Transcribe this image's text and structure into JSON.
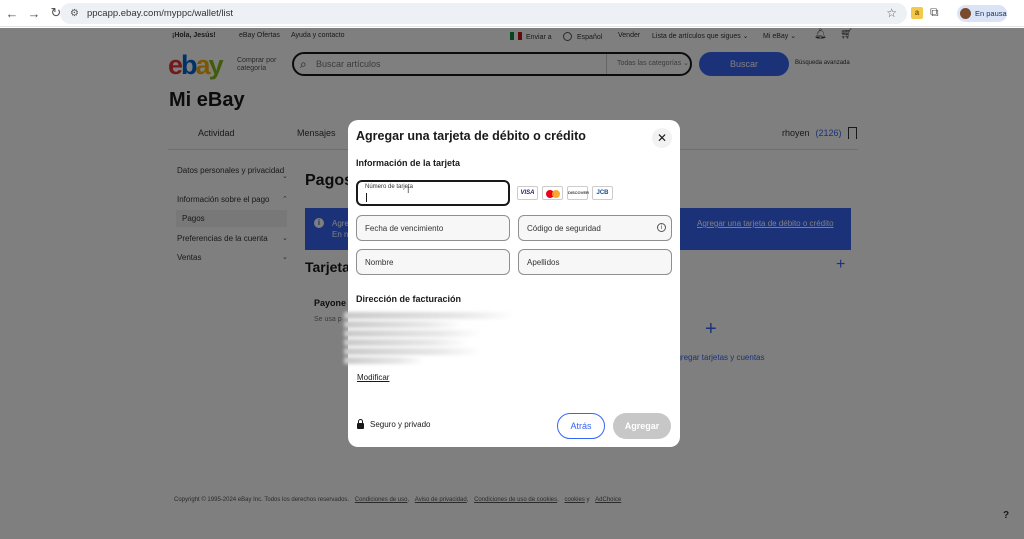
{
  "browser": {
    "url": "ppcapp.ebay.com/myppc/wallet/list",
    "profile_label": "En pausa"
  },
  "topbar": {
    "greeting": "¡Hola, Jesús!",
    "deals": "eBay Ofertas",
    "help": "Ayuda y contacto",
    "ship_to": "Enviar a",
    "language": "Español",
    "sell": "Vender",
    "watchlist": "Lista de artículos que sigues",
    "my_ebay": "Mi eBay"
  },
  "header": {
    "logo": {
      "e": "e",
      "b": "b",
      "a": "a",
      "y": "y"
    },
    "tagline_1": "Comprar por",
    "tagline_2": "categoría",
    "search_placeholder": "Buscar artículos",
    "category": "Todas las categorías",
    "search_button": "Buscar",
    "advanced": "Búsqueda avanzada"
  },
  "page": {
    "title": "Mi eBay",
    "tabs": [
      "Actividad",
      "Mensajes"
    ],
    "username": "rhoyen",
    "feedback": "(2126)",
    "sidebar": [
      {
        "label": "Datos personales y privacidad"
      },
      {
        "label": "Información sobre el pago"
      },
      {
        "label": "Pagos"
      },
      {
        "label": "Preferencias de la cuenta"
      },
      {
        "label": "Ventas"
      }
    ],
    "section_title": "Pagos",
    "banner_1": "Agre",
    "banner_2": "En n",
    "banner_link": "Agregar una tarjeta de débito o crédito",
    "cards_title": "Tarjeta",
    "payoneer": "Payone",
    "payoneer_sub": "Se usa p",
    "add_label": "agregar tarjetas y cuentas"
  },
  "footer": {
    "copyright": "Copyright © 1995-2024 eBay Inc. Todos los derechos reservados.",
    "links": [
      "Condiciones de uso",
      "Aviso de privacidad",
      "Condiciones de uso de cookies",
      "cookies",
      "AdChoice"
    ]
  },
  "modal": {
    "title": "Agregar una tarjeta de débito o crédito",
    "card_info": "Información de la tarjeta",
    "card_number_label": "Número de tarjeta",
    "expiry_label": "Fecha de vencimiento",
    "cvv_label": "Código de seguridad",
    "first_name_label": "Nombre",
    "last_name_label": "Apellidos",
    "billing_title": "Dirección de facturación",
    "modify_link": "Modificar",
    "secure_text": "Seguro y privado",
    "back_button": "Atrás",
    "add_button": "Agregar",
    "card_brands": [
      "VISA",
      "Mastercard",
      "DISCOVER",
      "JCB"
    ]
  },
  "colors": {
    "ebay_blue": "#3665f3",
    "logo_red": "#e53238",
    "logo_blue": "#0064d2",
    "logo_yellow": "#f5af02",
    "logo_green": "#86b817"
  }
}
